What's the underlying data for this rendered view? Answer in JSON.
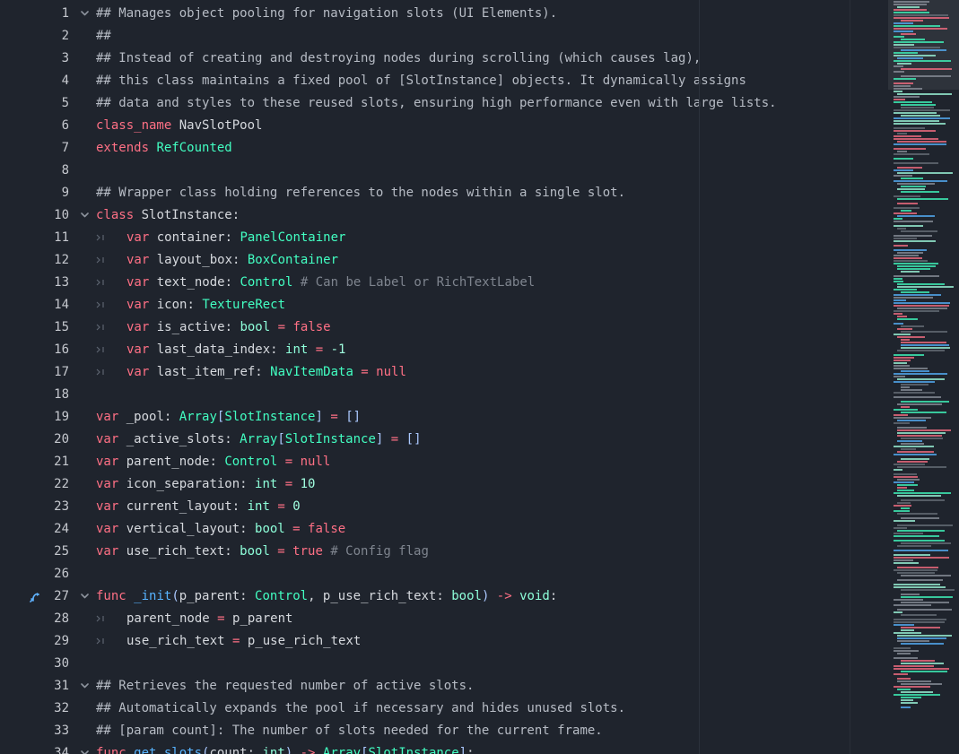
{
  "editor": {
    "colors": {
      "background": "#1f242d",
      "keyword": "#ff7085",
      "class_name": "#42ffc2",
      "type": "#8effda",
      "comment": "#7f858f",
      "doc_comment": "#b7bcc5",
      "function": "#57b3ff",
      "number": "#a1ffe0",
      "line_number": "#c5c8ce"
    },
    "lines": [
      {
        "n": "1",
        "fold": true,
        "tokens": [
          [
            "doc",
            "## Manages object pooling for navigation slots (UI Elements)."
          ]
        ]
      },
      {
        "n": "2",
        "tokens": [
          [
            "doc",
            "##"
          ]
        ]
      },
      {
        "n": "3",
        "tokens": [
          [
            "doc",
            "## Instead of creating and destroying nodes during scrolling (which causes lag),"
          ]
        ]
      },
      {
        "n": "4",
        "tokens": [
          [
            "doc",
            "## this class maintains a fixed pool of [SlotInstance] objects. It dynamically assigns"
          ]
        ]
      },
      {
        "n": "5",
        "tokens": [
          [
            "doc",
            "## data and styles to these reused slots, ensuring high performance even with large lists."
          ]
        ]
      },
      {
        "n": "6",
        "tokens": [
          [
            "kw",
            "class_name"
          ],
          [
            "id",
            " NavSlotPool"
          ]
        ]
      },
      {
        "n": "7",
        "tokens": [
          [
            "kw",
            "extends"
          ],
          [
            "id",
            " "
          ],
          [
            "cls",
            "RefCounted"
          ]
        ]
      },
      {
        "n": "8",
        "tokens": []
      },
      {
        "n": "9",
        "tokens": [
          [
            "doc",
            "## Wrapper class holding references to the nodes within a single slot."
          ]
        ]
      },
      {
        "n": "10",
        "fold": true,
        "tokens": [
          [
            "kw",
            "class"
          ],
          [
            "id",
            " SlotInstance:"
          ]
        ]
      },
      {
        "n": "11",
        "indent": 1,
        "tokens": [
          [
            "kw",
            "var"
          ],
          [
            "id",
            " container: "
          ],
          [
            "cls",
            "PanelContainer"
          ]
        ]
      },
      {
        "n": "12",
        "indent": 1,
        "tokens": [
          [
            "kw",
            "var"
          ],
          [
            "id",
            " layout_box: "
          ],
          [
            "cls",
            "BoxContainer"
          ]
        ]
      },
      {
        "n": "13",
        "indent": 1,
        "tokens": [
          [
            "kw",
            "var"
          ],
          [
            "id",
            " text_node: "
          ],
          [
            "cls",
            "Control"
          ],
          [
            "com",
            " # Can be Label or RichTextLabel"
          ]
        ]
      },
      {
        "n": "14",
        "indent": 1,
        "tokens": [
          [
            "kw",
            "var"
          ],
          [
            "id",
            " icon: "
          ],
          [
            "cls",
            "TextureRect"
          ]
        ]
      },
      {
        "n": "15",
        "indent": 1,
        "tokens": [
          [
            "kw",
            "var"
          ],
          [
            "id",
            " is_active: "
          ],
          [
            "type",
            "bool"
          ],
          [
            "kw",
            " = "
          ],
          [
            "bool",
            "false"
          ]
        ]
      },
      {
        "n": "16",
        "indent": 1,
        "tokens": [
          [
            "kw",
            "var"
          ],
          [
            "id",
            " last_data_index: "
          ],
          [
            "type",
            "int"
          ],
          [
            "kw",
            " = "
          ],
          [
            "num",
            "-1"
          ]
        ]
      },
      {
        "n": "17",
        "indent": 1,
        "tokens": [
          [
            "kw",
            "var"
          ],
          [
            "id",
            " last_item_ref: "
          ],
          [
            "cls",
            "NavItemData"
          ],
          [
            "kw",
            " = "
          ],
          [
            "bool",
            "null"
          ]
        ]
      },
      {
        "n": "18",
        "tokens": []
      },
      {
        "n": "19",
        "tokens": [
          [
            "kw",
            "var"
          ],
          [
            "id",
            " _pool: "
          ],
          [
            "cls",
            "Array"
          ],
          [
            "sym",
            "["
          ],
          [
            "cls",
            "SlotInstance"
          ],
          [
            "sym",
            "]"
          ],
          [
            "kw",
            " = "
          ],
          [
            "sym",
            "[]"
          ]
        ]
      },
      {
        "n": "20",
        "tokens": [
          [
            "kw",
            "var"
          ],
          [
            "id",
            " _active_slots: "
          ],
          [
            "cls",
            "Array"
          ],
          [
            "sym",
            "["
          ],
          [
            "cls",
            "SlotInstance"
          ],
          [
            "sym",
            "]"
          ],
          [
            "kw",
            " = "
          ],
          [
            "sym",
            "[]"
          ]
        ]
      },
      {
        "n": "21",
        "tokens": [
          [
            "kw",
            "var"
          ],
          [
            "id",
            " parent_node: "
          ],
          [
            "cls",
            "Control"
          ],
          [
            "kw",
            " = "
          ],
          [
            "bool",
            "null"
          ]
        ]
      },
      {
        "n": "22",
        "tokens": [
          [
            "kw",
            "var"
          ],
          [
            "id",
            " icon_separation: "
          ],
          [
            "type",
            "int"
          ],
          [
            "kw",
            " = "
          ],
          [
            "num",
            "10"
          ]
        ]
      },
      {
        "n": "23",
        "tokens": [
          [
            "kw",
            "var"
          ],
          [
            "id",
            " current_layout: "
          ],
          [
            "type",
            "int"
          ],
          [
            "kw",
            " = "
          ],
          [
            "num",
            "0"
          ]
        ]
      },
      {
        "n": "24",
        "tokens": [
          [
            "kw",
            "var"
          ],
          [
            "id",
            " vertical_layout: "
          ],
          [
            "type",
            "bool"
          ],
          [
            "kw",
            " = "
          ],
          [
            "bool",
            "false"
          ]
        ]
      },
      {
        "n": "25",
        "tokens": [
          [
            "kw",
            "var"
          ],
          [
            "id",
            " use_rich_text: "
          ],
          [
            "type",
            "bool"
          ],
          [
            "kw",
            " = "
          ],
          [
            "bool",
            "true"
          ],
          [
            "com",
            " # Config flag"
          ]
        ]
      },
      {
        "n": "26",
        "tokens": []
      },
      {
        "n": "27",
        "fold": true,
        "override": true,
        "tokens": [
          [
            "kw",
            "func"
          ],
          [
            "id",
            " "
          ],
          [
            "fn",
            "_init"
          ],
          [
            "sym",
            "("
          ],
          [
            "id",
            "p_parent: "
          ],
          [
            "cls",
            "Control"
          ],
          [
            "id",
            ", p_use_rich_text: "
          ],
          [
            "type",
            "bool"
          ],
          [
            "sym",
            ")"
          ],
          [
            "kw",
            " -> "
          ],
          [
            "type",
            "void"
          ],
          [
            "id",
            ":"
          ]
        ]
      },
      {
        "n": "28",
        "indent": 1,
        "tokens": [
          [
            "id",
            "parent_node "
          ],
          [
            "kw",
            "="
          ],
          [
            "id",
            " p_parent"
          ]
        ]
      },
      {
        "n": "29",
        "indent": 1,
        "tokens": [
          [
            "id",
            "use_rich_text "
          ],
          [
            "kw",
            "="
          ],
          [
            "id",
            " p_use_rich_text"
          ]
        ]
      },
      {
        "n": "30",
        "tokens": []
      },
      {
        "n": "31",
        "fold": true,
        "tokens": [
          [
            "doc",
            "## Retrieves the requested number of active slots."
          ]
        ]
      },
      {
        "n": "32",
        "tokens": [
          [
            "doc",
            "## Automatically expands the pool if necessary and hides unused slots."
          ]
        ]
      },
      {
        "n": "33",
        "tokens": [
          [
            "doc",
            "## [param count]: The number of slots needed for the current frame."
          ]
        ]
      },
      {
        "n": "34",
        "fold": true,
        "tokens": [
          [
            "kw",
            "func"
          ],
          [
            "id",
            " "
          ],
          [
            "fn",
            "get_slots"
          ],
          [
            "sym",
            "("
          ],
          [
            "id",
            "count: "
          ],
          [
            "type",
            "int"
          ],
          [
            "sym",
            ")"
          ],
          [
            "kw",
            " -> "
          ],
          [
            "cls",
            "Array"
          ],
          [
            "sym",
            "["
          ],
          [
            "cls",
            "SlotInstance"
          ],
          [
            "sym",
            "]"
          ],
          [
            "id",
            ":"
          ]
        ]
      }
    ]
  }
}
